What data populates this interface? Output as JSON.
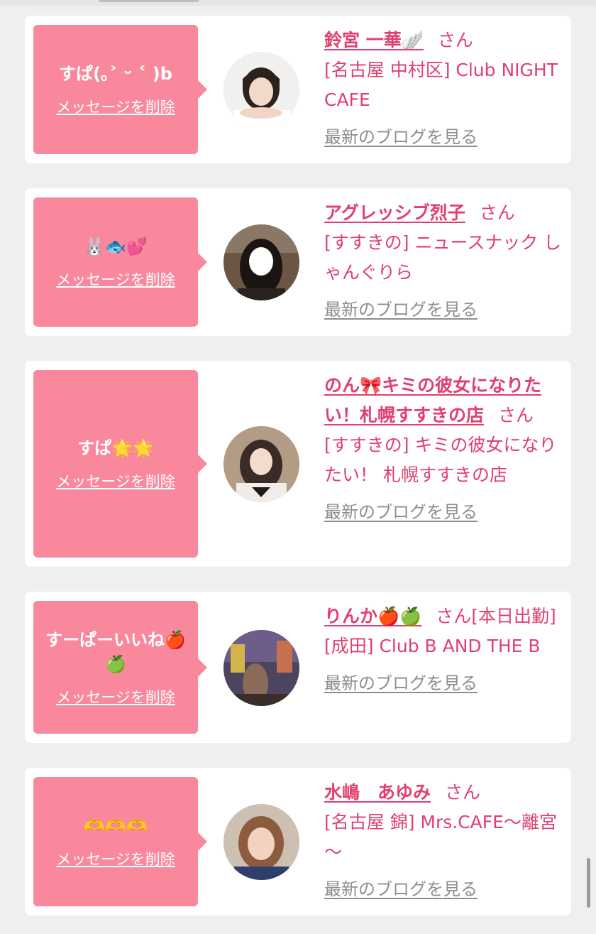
{
  "colors": {
    "accent": "#e23e6e",
    "bubble": "#f9889d",
    "link_gray": "#8e8e8e",
    "card_bg": "#ffffff",
    "page_bg": "#efefef"
  },
  "items": [
    {
      "message": "すぱ(｡˃ ᵕ ˂ )b",
      "delete_label": "メッセージを削除",
      "name": "鈴宮 一華🪽",
      "san": "さん",
      "shop": "[名古屋 中村区] Club NIGHT CAFE",
      "blog_label": "最新のブログを見る"
    },
    {
      "message": "🐰🐟💕",
      "delete_label": "メッセージを削除",
      "name": "アグレッシブ烈子",
      "san": "さん",
      "shop": "[すすきの] ニュースナック しゃんぐりら",
      "blog_label": "最新のブログを見る"
    },
    {
      "message": "すぱ🌟🌟",
      "delete_label": "メッセージを削除",
      "name": "のん🎀キミの彼女になりたい！札幌すすきの店",
      "san": "さん",
      "shop": "[すすきの] キミの彼女になりたい！ 札幌すすきの店",
      "blog_label": "最新のブログを見る"
    },
    {
      "message": "すーぱーいいね🍎🍏",
      "delete_label": "メッセージを削除",
      "name": "りんか🍎🍏",
      "san": "さん[本日出勤]",
      "shop": "[成田] Club B AND THE B",
      "blog_label": "最新のブログを見る"
    },
    {
      "message": "🫶🫶🫶",
      "delete_label": "メッセージを削除",
      "name": "水嶋　あゆみ",
      "san": "さん",
      "shop": "[名古屋 錦] Mrs.CAFE～離宮～",
      "blog_label": "最新のブログを見る"
    }
  ]
}
